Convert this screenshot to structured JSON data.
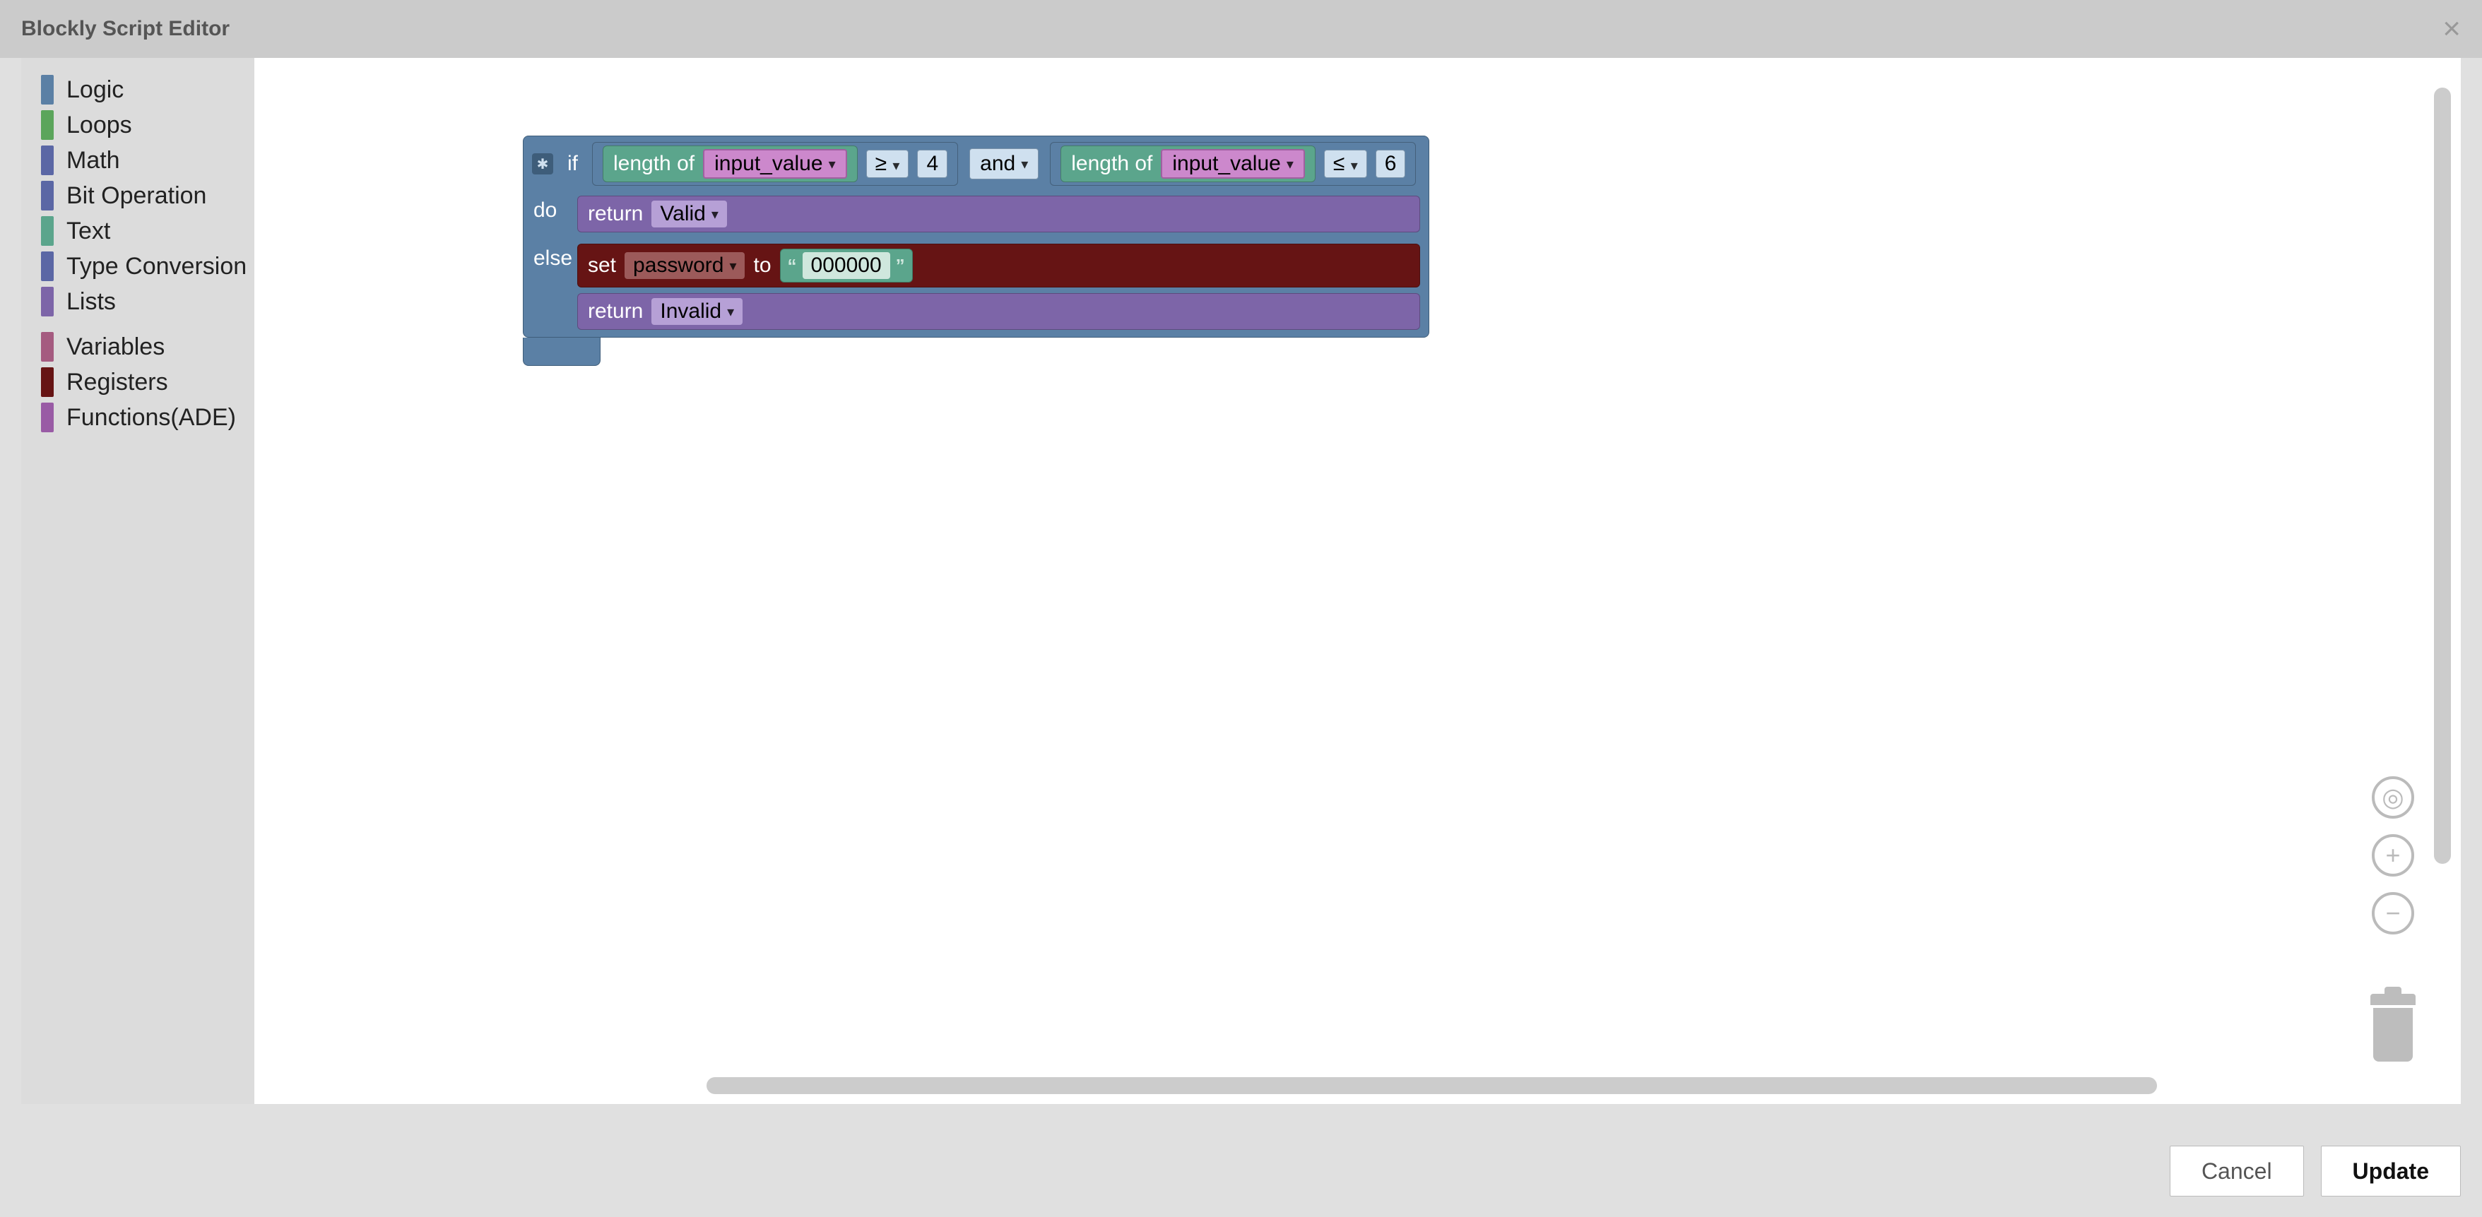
{
  "titlebar": {
    "title": "Blockly Script Editor"
  },
  "toolbox": {
    "groups": [
      [
        {
          "label": "Logic",
          "color": "#5b80a5"
        },
        {
          "label": "Loops",
          "color": "#5ba55b"
        },
        {
          "label": "Math",
          "color": "#5b67a5"
        },
        {
          "label": "Bit Operation",
          "color": "#5b67a5"
        },
        {
          "label": "Text",
          "color": "#5ba58c"
        },
        {
          "label": "Type Conversion",
          "color": "#5b67a5"
        },
        {
          "label": "Lists",
          "color": "#7d65a8"
        }
      ],
      [
        {
          "label": "Variables",
          "color": "#a55b80"
        },
        {
          "label": "Registers",
          "color": "#661414"
        },
        {
          "label": "Functions(ADE)",
          "color": "#995ba5"
        }
      ]
    ]
  },
  "blocks": {
    "if_label": "if",
    "do_label": "do",
    "else_label": "else",
    "length_of": "length of",
    "and": "and",
    "return": "return",
    "set": "set",
    "to": "to",
    "cond": {
      "left": {
        "var": "input_value",
        "op": "≥",
        "num": "4"
      },
      "right": {
        "var": "input_value",
        "op": "≤",
        "num": "6"
      }
    },
    "do_body": {
      "return_value": "Valid"
    },
    "else_body": {
      "set_var": "password",
      "set_value": "000000",
      "return_value": "Invalid"
    }
  },
  "footer": {
    "cancel": "Cancel",
    "update": "Update"
  }
}
